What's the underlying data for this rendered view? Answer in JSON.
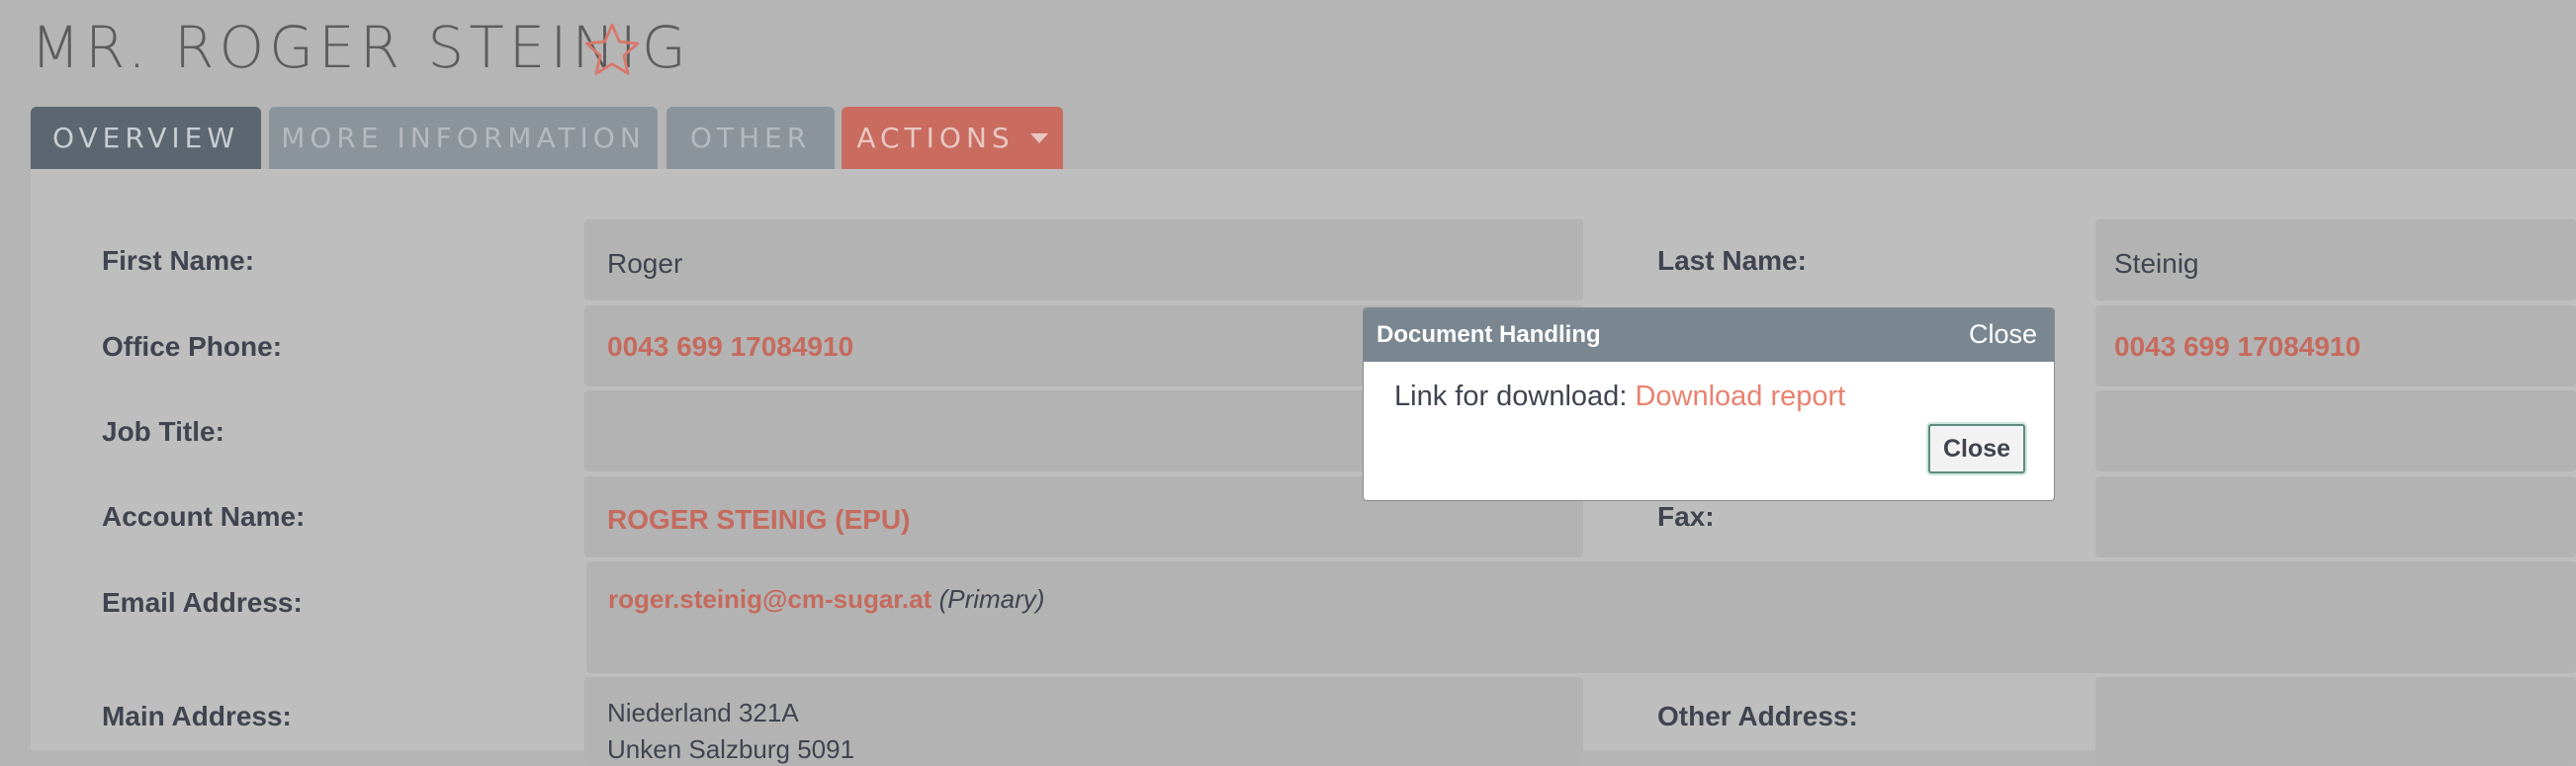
{
  "record": {
    "title": "MR. ROGER STEINIG"
  },
  "tabs": [
    {
      "label": "OVERVIEW"
    },
    {
      "label": "MORE INFORMATION"
    },
    {
      "label": "OTHER"
    },
    {
      "label": "ACTIONS"
    }
  ],
  "fields": {
    "first_name": {
      "label": "First Name:",
      "value": "Roger"
    },
    "last_name": {
      "label": "Last Name:",
      "value": "Steinig"
    },
    "office_phone": {
      "label": "Office Phone:",
      "value": "0043 699 17084910"
    },
    "mobile_phone": {
      "value": "0043 699 17084910"
    },
    "job_title": {
      "label": "Job Title:"
    },
    "account_name": {
      "label": "Account Name:",
      "value": "ROGER STEINIG (EPU)"
    },
    "fax": {
      "label": "Fax:"
    },
    "email": {
      "label": "Email Address:",
      "value": "roger.steinig@cm-sugar.at",
      "tag": "(Primary)"
    },
    "main_address": {
      "label": "Main Address:",
      "line1": "Niederland 321A",
      "line2": "Unken Salzburg  5091"
    },
    "other_address": {
      "label": "Other Address:"
    }
  },
  "dialog": {
    "title": "Document Handling",
    "close_link": "Close",
    "text": "Link for download: ",
    "download_link": "Download report",
    "close_button": "Close"
  },
  "colors": {
    "accent": "#c56a5d",
    "tab_active": "#5b6670",
    "dialog_header": "#7a8791"
  }
}
